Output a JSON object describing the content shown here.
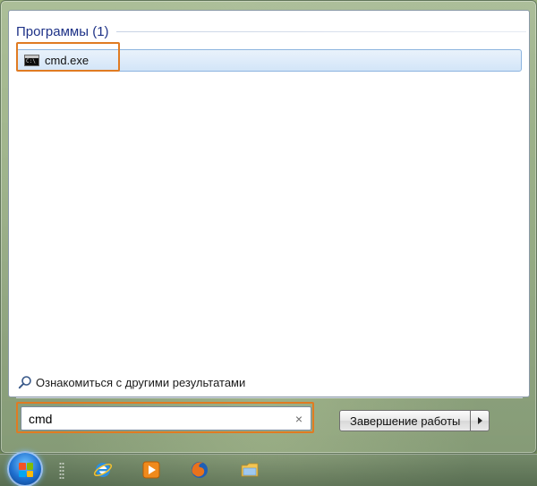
{
  "results": {
    "section_title": "Программы (1)",
    "items": [
      {
        "label": "cmd.exe",
        "icon": "console-icon"
      }
    ]
  },
  "see_more": {
    "label": "Ознакомиться с другими результатами",
    "icon": "search-icon"
  },
  "search": {
    "value": "cmd",
    "clear_icon": "×"
  },
  "power": {
    "shutdown_label": "Завершение работы"
  },
  "taskbar": {
    "items": [
      "start-orb",
      "internet-explorer-icon",
      "media-player-icon",
      "firefox-icon",
      "file-explorer-icon"
    ]
  },
  "colors": {
    "highlight": "#e07b22",
    "section_title": "#1e3287",
    "selection_border": "#8cb4df"
  }
}
